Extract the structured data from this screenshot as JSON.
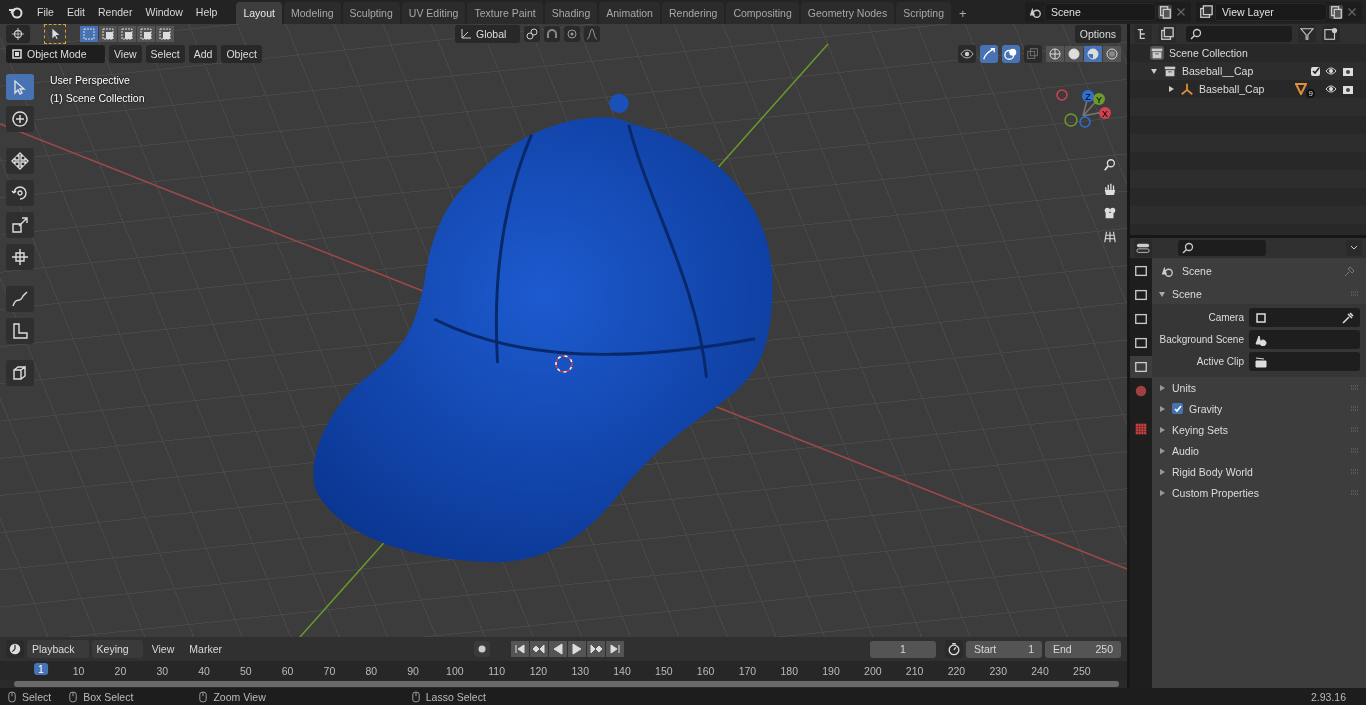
{
  "menu": [
    "File",
    "Edit",
    "Render",
    "Window",
    "Help"
  ],
  "workspaces": [
    {
      "label": "Layout",
      "selected": true
    },
    {
      "label": "Modeling",
      "selected": false
    },
    {
      "label": "Sculpting",
      "selected": false
    },
    {
      "label": "UV Editing",
      "selected": false
    },
    {
      "label": "Texture Paint",
      "selected": false
    },
    {
      "label": "Shading",
      "selected": false
    },
    {
      "label": "Animation",
      "selected": false
    },
    {
      "label": "Rendering",
      "selected": false
    },
    {
      "label": "Compositing",
      "selected": false
    },
    {
      "label": "Geometry Nodes",
      "selected": false
    },
    {
      "label": "Scripting",
      "selected": false
    }
  ],
  "add_workspace": "+",
  "scene": "Scene",
  "view_layer": "View Layer",
  "viewport": {
    "select_modes": [
      {
        "selected": true
      },
      {
        "selected": false
      },
      {
        "selected": false
      },
      {
        "selected": false
      },
      {
        "selected": false
      }
    ],
    "orientation": "Global",
    "options": "Options",
    "mode": "Object Mode",
    "menus": [
      "View",
      "Select",
      "Add",
      "Object"
    ],
    "shading": [
      {
        "selected": false
      },
      {
        "selected": false
      },
      {
        "selected": true
      },
      {
        "selected": false
      }
    ],
    "overlay_text": [
      "User Perspective",
      "(1) Scene Collection"
    ],
    "tools": [
      {
        "selected": true
      },
      {
        "selected": false
      },
      {
        "selected": false
      },
      {
        "selected": false
      },
      {
        "selected": false
      },
      {
        "selected": false
      },
      {
        "selected": false
      },
      {
        "selected": false
      },
      {
        "selected": false
      }
    ],
    "gizmo_axes": [
      "Z",
      "Y",
      "X"
    ]
  },
  "outliner": {
    "tree": [
      {
        "label": "Scene Collection",
        "children": [
          {
            "label": "Baseball__Cap",
            "expanded": true,
            "checked": true,
            "children": [
              {
                "label": "Baseball_Cap",
                "expanded": false,
                "badge": "9"
              }
            ]
          }
        ]
      }
    ]
  },
  "properties": {
    "tabs": [
      {
        "selected": false
      },
      {
        "selected": false
      },
      {
        "selected": false
      },
      {
        "selected": false
      },
      {
        "selected": true
      },
      {
        "selected": false
      },
      {
        "selected": false
      }
    ],
    "context": "Scene",
    "panel": {
      "title": "Scene",
      "expanded": true,
      "fields": [
        {
          "label": "Camera"
        },
        {
          "label": "Background Scene"
        },
        {
          "label": "Active Clip"
        }
      ]
    },
    "subpanels": [
      {
        "title": "Units",
        "kind": "plain",
        "expanded": false
      },
      {
        "title": "Gravity",
        "kind": "toggle",
        "checked": true,
        "expanded": false
      },
      {
        "title": "Keying Sets",
        "kind": "plain",
        "expanded": false
      },
      {
        "title": "Audio",
        "kind": "plain",
        "expanded": false
      },
      {
        "title": "Rigid Body World",
        "kind": "plain",
        "expanded": false
      },
      {
        "title": "Custom Properties",
        "kind": "plain",
        "expanded": false
      }
    ]
  },
  "timeline": {
    "menus": [
      "Playback",
      "Keying"
    ],
    "plain_menus": [
      "View",
      "Marker"
    ],
    "current_frame": "1",
    "start_label": "Start",
    "start": "1",
    "end_label": "End",
    "end": "250",
    "ticks": [
      "1",
      "10",
      "20",
      "30",
      "40",
      "50",
      "60",
      "70",
      "80",
      "90",
      "100",
      "110",
      "120",
      "130",
      "140",
      "150",
      "160",
      "170",
      "180",
      "190",
      "200",
      "210",
      "220",
      "230",
      "240",
      "250"
    ]
  },
  "status_bar": {
    "hints": [
      "Select",
      "Box Select",
      "Zoom View",
      "Lasso Select"
    ],
    "version": "2.93.16"
  }
}
